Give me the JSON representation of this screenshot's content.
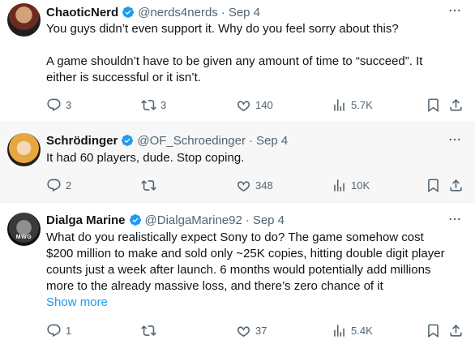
{
  "tweets": [
    {
      "name": "ChaoticNerd",
      "handle": "@nerds4nerds",
      "date": "Sep 4",
      "avatar_text": "",
      "text_lines": [
        "You guys didn’t even support it. Why do you feel sorry about this?",
        "",
        "A game shouldn’t have to be given any amount of time to “succeed”. It",
        "either is successful or it isn’t."
      ],
      "show_more": "",
      "replies": "3",
      "reposts": "3",
      "likes": "140",
      "views": "5.7K"
    },
    {
      "name": "Schrödinger",
      "handle": "@OF_Schroedinger",
      "date": "Sep 4",
      "avatar_text": "",
      "text_lines": [
        "It had 60 players, dude. Stop coping."
      ],
      "show_more": "",
      "replies": "2",
      "reposts": "",
      "likes": "348",
      "views": "10K"
    },
    {
      "name": "Dialga Marine",
      "handle": "@DialgaMarine92",
      "date": "Sep 4",
      "avatar_text": "MWG",
      "text_lines": [
        "What do you realistically expect Sony to do? The game somehow cost",
        "$200 million to make and sold only ~25K copies, hitting double digit player",
        "counts just a week after launch. 6 months would potentially add millions",
        "more to the already massive loss, and there’s zero chance of it"
      ],
      "show_more": "Show more",
      "replies": "1",
      "reposts": "",
      "likes": "37",
      "views": "5.4K"
    }
  ],
  "colors": {
    "accent": "#1d9bf0",
    "muted": "#536471",
    "text": "#0f1419"
  }
}
